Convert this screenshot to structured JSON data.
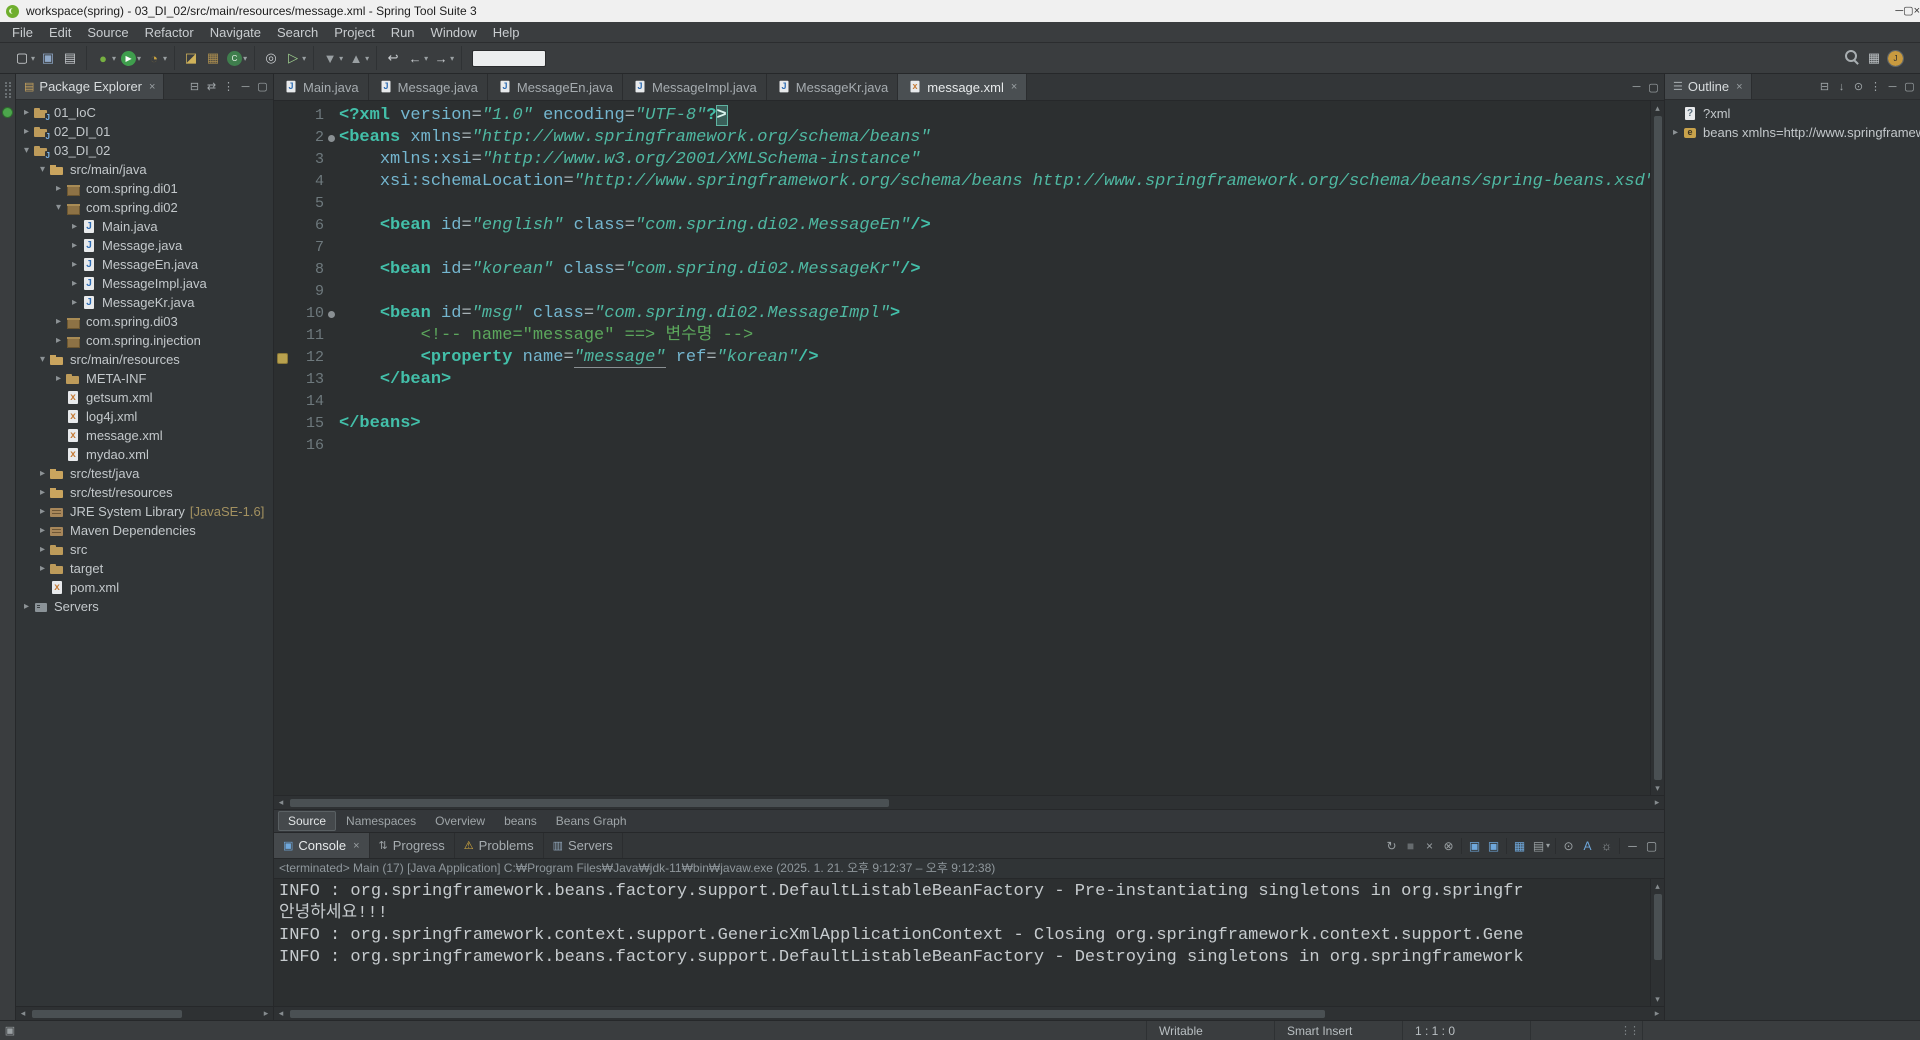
{
  "titlebar": {
    "title": "workspace(spring) - 03_DI_02/src/main/resources/message.xml - Spring Tool Suite 3",
    "controls": [
      "minimize",
      "maximize",
      "close"
    ]
  },
  "menubar": [
    "File",
    "Edit",
    "Source",
    "Refactor",
    "Navigate",
    "Search",
    "Project",
    "Run",
    "Window",
    "Help"
  ],
  "toolbar": {
    "groups": [
      [
        {
          "name": "new-wizard",
          "dd": true
        },
        {
          "name": "save"
        },
        {
          "name": "print"
        }
      ],
      [
        {
          "name": "debug",
          "dd": true
        },
        {
          "name": "run",
          "dd": true
        },
        {
          "name": "profile",
          "dd": true
        }
      ],
      [
        {
          "name": "new-java-project"
        },
        {
          "name": "new-package"
        },
        {
          "name": "new-class",
          "dd": true
        }
      ],
      [
        {
          "name": "search-files"
        },
        {
          "name": "external-tools",
          "dd": true
        }
      ],
      [
        {
          "name": "next-annotation",
          "dd": true
        },
        {
          "name": "prev-annotation",
          "dd": true
        }
      ],
      [
        {
          "name": "last-edit"
        },
        {
          "name": "back",
          "dd": true
        },
        {
          "name": "forward",
          "dd": true
        }
      ]
    ],
    "field_value": "",
    "right": [
      {
        "name": "search"
      },
      {
        "name": "open-perspective"
      },
      {
        "name": "java-perspective",
        "active": true
      }
    ]
  },
  "package_explorer": {
    "title": "Package Explorer",
    "toolbar_icons": [
      "collapse-all",
      "link-with-editor",
      "view-menu",
      "minimize",
      "maximize"
    ],
    "tree": [
      {
        "label": "01_IoC",
        "level": 0,
        "icon": "java-project",
        "arrow": "collapsed"
      },
      {
        "label": "02_DI_01",
        "level": 0,
        "icon": "java-project",
        "arrow": "collapsed"
      },
      {
        "label": "03_DI_02",
        "level": 0,
        "icon": "java-project",
        "arrow": "expanded"
      },
      {
        "label": "src/main/java",
        "level": 1,
        "icon": "source-folder",
        "arrow": "expanded"
      },
      {
        "label": "com.spring.di01",
        "level": 2,
        "icon": "package",
        "arrow": "collapsed"
      },
      {
        "label": "com.spring.di02",
        "level": 2,
        "icon": "package",
        "arrow": "expanded"
      },
      {
        "label": "Main.java",
        "level": 3,
        "icon": "java-file",
        "arrow": "collapsed"
      },
      {
        "label": "Message.java",
        "level": 3,
        "icon": "java-file",
        "arrow": "collapsed"
      },
      {
        "label": "MessageEn.java",
        "level": 3,
        "icon": "java-file",
        "arrow": "collapsed"
      },
      {
        "label": "MessageImpl.java",
        "level": 3,
        "icon": "java-file",
        "arrow": "collapsed"
      },
      {
        "label": "MessageKr.java",
        "level": 3,
        "icon": "java-file",
        "arrow": "collapsed"
      },
      {
        "label": "com.spring.di03",
        "level": 2,
        "icon": "package",
        "arrow": "collapsed"
      },
      {
        "label": "com.spring.injection",
        "level": 2,
        "icon": "package",
        "arrow": "collapsed"
      },
      {
        "label": "src/main/resources",
        "level": 1,
        "icon": "source-folder",
        "arrow": "expanded"
      },
      {
        "label": "META-INF",
        "level": 2,
        "icon": "folder",
        "arrow": "collapsed"
      },
      {
        "label": "getsum.xml",
        "level": 2,
        "icon": "xml-file",
        "arrow": "none"
      },
      {
        "label": "log4j.xml",
        "level": 2,
        "icon": "xml-file",
        "arrow": "none"
      },
      {
        "label": "message.xml",
        "level": 2,
        "icon": "xml-file",
        "arrow": "none"
      },
      {
        "label": "mydao.xml",
        "level": 2,
        "icon": "xml-file",
        "arrow": "none"
      },
      {
        "label": "src/test/java",
        "level": 1,
        "icon": "source-folder",
        "arrow": "collapsed"
      },
      {
        "label": "src/test/resources",
        "level": 1,
        "icon": "source-folder",
        "arrow": "collapsed"
      },
      {
        "label": "JRE System Library",
        "suffix": "[JavaSE-1.6]",
        "level": 1,
        "icon": "library",
        "arrow": "collapsed"
      },
      {
        "label": "Maven Dependencies",
        "level": 1,
        "icon": "library",
        "arrow": "collapsed"
      },
      {
        "label": "src",
        "level": 1,
        "icon": "folder",
        "arrow": "collapsed"
      },
      {
        "label": "target",
        "level": 1,
        "icon": "folder",
        "arrow": "collapsed"
      },
      {
        "label": "pom.xml",
        "level": 1,
        "icon": "xml-file",
        "arrow": "none"
      },
      {
        "label": "Servers",
        "level": 0,
        "icon": "server",
        "arrow": "collapsed"
      }
    ]
  },
  "editor": {
    "tabs": [
      {
        "label": "Main.java",
        "icon": "java"
      },
      {
        "label": "Message.java",
        "icon": "java"
      },
      {
        "label": "MessageEn.java",
        "icon": "java"
      },
      {
        "label": "MessageImpl.java",
        "icon": "java"
      },
      {
        "label": "MessageKr.java",
        "icon": "java"
      },
      {
        "label": "message.xml",
        "icon": "xml",
        "active": true,
        "closable": true
      }
    ],
    "window_icons": [
      "minimize",
      "maximize"
    ],
    "lines": [
      {
        "n": 1,
        "tokens": [
          {
            "c": "b",
            "s": "<?"
          },
          {
            "c": "t",
            "s": "xml"
          },
          {
            "c": "p",
            "s": " "
          },
          {
            "c": "a",
            "s": "version"
          },
          {
            "c": "e",
            "s": "="
          },
          {
            "c": "v",
            "s": "\"1.0\""
          },
          {
            "c": "p",
            "s": " "
          },
          {
            "c": "a",
            "s": "encoding"
          },
          {
            "c": "e",
            "s": "="
          },
          {
            "c": "v",
            "s": "\"UTF-8\""
          },
          {
            "c": "b",
            "s": "?"
          },
          {
            "c": "hl",
            "s": ">"
          }
        ]
      },
      {
        "n": 2,
        "fold": true,
        "tokens": [
          {
            "c": "b",
            "s": "<"
          },
          {
            "c": "t",
            "s": "beans"
          },
          {
            "c": "p",
            "s": " "
          },
          {
            "c": "a",
            "s": "xmlns"
          },
          {
            "c": "e",
            "s": "="
          },
          {
            "c": "v",
            "s": "\"http://www.springframework.org/schema/beans\""
          }
        ]
      },
      {
        "n": 3,
        "tokens": [
          {
            "c": "p",
            "s": "    "
          },
          {
            "c": "a",
            "s": "xmlns:xsi"
          },
          {
            "c": "e",
            "s": "="
          },
          {
            "c": "v",
            "s": "\"http://www.w3.org/2001/XMLSchema-instance\""
          }
        ]
      },
      {
        "n": 4,
        "tokens": [
          {
            "c": "p",
            "s": "    "
          },
          {
            "c": "a",
            "s": "xsi:schemaLocation"
          },
          {
            "c": "e",
            "s": "="
          },
          {
            "c": "v",
            "s": "\"http://www.springframework.org/schema/beans http://www.springframework.org/schema/beans/spring-beans.xsd\""
          },
          {
            "c": "b",
            "s": ">"
          }
        ]
      },
      {
        "n": 5,
        "tokens": []
      },
      {
        "n": 6,
        "tokens": [
          {
            "c": "p",
            "s": "    "
          },
          {
            "c": "b",
            "s": "<"
          },
          {
            "c": "t",
            "s": "bean"
          },
          {
            "c": "p",
            "s": " "
          },
          {
            "c": "a",
            "s": "id"
          },
          {
            "c": "e",
            "s": "="
          },
          {
            "c": "v",
            "s": "\"english\""
          },
          {
            "c": "p",
            "s": " "
          },
          {
            "c": "a",
            "s": "class"
          },
          {
            "c": "e",
            "s": "="
          },
          {
            "c": "v",
            "s": "\"com.spring.di02.MessageEn\""
          },
          {
            "c": "b",
            "s": "/>"
          }
        ]
      },
      {
        "n": 7,
        "tokens": []
      },
      {
        "n": 8,
        "tokens": [
          {
            "c": "p",
            "s": "    "
          },
          {
            "c": "b",
            "s": "<"
          },
          {
            "c": "t",
            "s": "bean"
          },
          {
            "c": "p",
            "s": " "
          },
          {
            "c": "a",
            "s": "id"
          },
          {
            "c": "e",
            "s": "="
          },
          {
            "c": "v",
            "s": "\"korean\""
          },
          {
            "c": "p",
            "s": " "
          },
          {
            "c": "a",
            "s": "class"
          },
          {
            "c": "e",
            "s": "="
          },
          {
            "c": "v",
            "s": "\"com.spring.di02.MessageKr\""
          },
          {
            "c": "b",
            "s": "/>"
          }
        ]
      },
      {
        "n": 9,
        "tokens": []
      },
      {
        "n": 10,
        "fold": true,
        "tokens": [
          {
            "c": "p",
            "s": "    "
          },
          {
            "c": "b",
            "s": "<"
          },
          {
            "c": "t",
            "s": "bean"
          },
          {
            "c": "p",
            "s": " "
          },
          {
            "c": "a",
            "s": "id"
          },
          {
            "c": "e",
            "s": "="
          },
          {
            "c": "v",
            "s": "\"msg\""
          },
          {
            "c": "p",
            "s": " "
          },
          {
            "c": "a",
            "s": "class"
          },
          {
            "c": "e",
            "s": "="
          },
          {
            "c": "v",
            "s": "\"com.spring.di02.MessageImpl\""
          },
          {
            "c": "b",
            "s": ">"
          }
        ]
      },
      {
        "n": 11,
        "tokens": [
          {
            "c": "p",
            "s": "        "
          },
          {
            "c": "cm",
            "s": "<!-- name=\"message\" ==> 변수명 -->"
          }
        ]
      },
      {
        "n": 12,
        "marker": true,
        "tokens": [
          {
            "c": "p",
            "s": "        "
          },
          {
            "c": "b",
            "s": "<"
          },
          {
            "c": "t",
            "s": "property"
          },
          {
            "c": "p",
            "s": " "
          },
          {
            "c": "a",
            "s": "name"
          },
          {
            "c": "e",
            "s": "="
          },
          {
            "c": "u",
            "s": "\"message\""
          },
          {
            "c": "p",
            "s": " "
          },
          {
            "c": "a",
            "s": "ref"
          },
          {
            "c": "e",
            "s": "="
          },
          {
            "c": "v",
            "s": "\"korean\""
          },
          {
            "c": "b",
            "s": "/>"
          }
        ]
      },
      {
        "n": 13,
        "tokens": [
          {
            "c": "p",
            "s": "    "
          },
          {
            "c": "b",
            "s": "</"
          },
          {
            "c": "t",
            "s": "bean"
          },
          {
            "c": "b",
            "s": ">"
          }
        ]
      },
      {
        "n": 14,
        "tokens": []
      },
      {
        "n": 15,
        "tokens": [
          {
            "c": "b",
            "s": "</"
          },
          {
            "c": "t",
            "s": "beans"
          },
          {
            "c": "b",
            "s": ">"
          }
        ]
      },
      {
        "n": 16,
        "tokens": []
      }
    ],
    "sub_tabs": [
      {
        "label": "Source",
        "active": true
      },
      {
        "label": "Namespaces"
      },
      {
        "label": "Overview"
      },
      {
        "label": "beans"
      },
      {
        "label": "Beans Graph"
      }
    ]
  },
  "console": {
    "tabs": [
      {
        "label": "Console",
        "icon": "console",
        "active": true,
        "closable": true
      },
      {
        "label": "Progress",
        "icon": "progress"
      },
      {
        "label": "Problems",
        "icon": "problems"
      },
      {
        "label": "Servers",
        "icon": "servers"
      }
    ],
    "toolbar_icons": [
      {
        "name": "relaunch"
      },
      {
        "name": "terminate"
      },
      {
        "name": "remove-launch"
      },
      {
        "name": "remove-all-launches"
      },
      {
        "sep": true
      },
      {
        "name": "show-console-out"
      },
      {
        "name": "show-console-err"
      },
      {
        "sep": true
      },
      {
        "name": "display-console"
      },
      {
        "name": "open-console",
        "dd": true
      },
      {
        "sep": true
      },
      {
        "name": "pin-console"
      },
      {
        "name": "word-wrap"
      },
      {
        "name": "preferences"
      },
      {
        "sep": true
      },
      {
        "name": "minimize"
      },
      {
        "name": "maximize"
      }
    ],
    "status_line": "<terminated> Main (17) [Java Application] C:₩Program Files₩Java₩jdk-11₩bin₩javaw.exe  (2025. 1. 21. 오후 9:12:37 – 오후 9:12:38)",
    "output": [
      "INFO : org.springframework.beans.factory.support.DefaultListableBeanFactory - Pre-instantiating singletons in org.springfr",
      "안녕하세요!!!",
      "INFO : org.springframework.context.support.GenericXmlApplicationContext - Closing org.springframework.context.support.Gene",
      "INFO : org.springframework.beans.factory.support.DefaultListableBeanFactory - Destroying singletons in org.springframework"
    ]
  },
  "outline": {
    "title": "Outline",
    "toolbar_icons": [
      "collapse-all",
      "sort",
      "focus",
      "view-menu",
      "minimize",
      "maximize"
    ],
    "items": [
      {
        "label": "?xml",
        "icon": "xml-decl",
        "arrow": "none"
      },
      {
        "label": "beans xmlns=http://www.springframework.org/schema/beans",
        "icon": "xml-element",
        "arrow": "collapsed"
      }
    ]
  },
  "statusbar": {
    "writable": "Writable",
    "input_mode": "Smart Insert",
    "caret_position": "1 : 1 : 0"
  }
}
